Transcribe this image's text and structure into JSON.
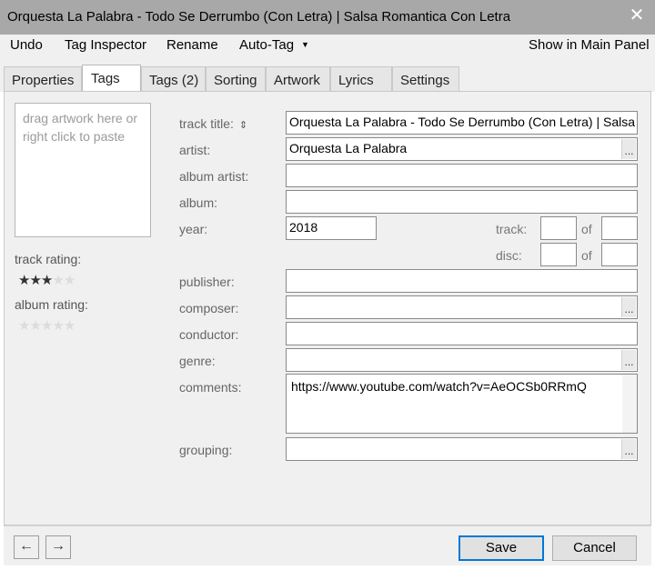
{
  "window": {
    "title": "Orquesta La Palabra - Todo Se Derrumbo (Con Letra) | Salsa Romantica Con Letra",
    "close_glyph": "✕"
  },
  "menu": {
    "undo": "Undo",
    "tag_inspector": "Tag Inspector",
    "rename": "Rename",
    "auto_tag": "Auto-Tag",
    "show_in_main_panel": "Show in Main Panel"
  },
  "tabs": [
    {
      "label": "Properties",
      "active": false
    },
    {
      "label": "Tags",
      "active": true
    },
    {
      "label": "Tags (2)",
      "active": false
    },
    {
      "label": "Sorting",
      "active": false
    },
    {
      "label": "Artwork",
      "active": false
    },
    {
      "label": "Lyrics",
      "active": false
    },
    {
      "label": "Settings",
      "active": false
    }
  ],
  "artwork": {
    "placeholder": "drag artwork here or right click to paste"
  },
  "ratings": {
    "track_rating_label": "track rating:",
    "track_rating_value": 3,
    "album_rating_label": "album rating:",
    "album_rating_value": 0,
    "max": 5
  },
  "fields": {
    "track_title": {
      "label": "track title:",
      "value": "Orquesta La Palabra - Todo Se Derrumbo (Con Letra) | Salsa Romantica Con Letra"
    },
    "artist": {
      "label": "artist:",
      "value": "Orquesta La Palabra"
    },
    "album_artist": {
      "label": "album artist:",
      "value": ""
    },
    "album": {
      "label": "album:",
      "value": ""
    },
    "year": {
      "label": "year:",
      "value": "2018"
    },
    "track": {
      "label": "track:",
      "value": "",
      "of_label": "of",
      "of_value": ""
    },
    "disc": {
      "label": "disc:",
      "value": "",
      "of_label": "of",
      "of_value": ""
    },
    "publisher": {
      "label": "publisher:",
      "value": ""
    },
    "composer": {
      "label": "composer:",
      "value": ""
    },
    "conductor": {
      "label": "conductor:",
      "value": ""
    },
    "genre": {
      "label": "genre:",
      "value": ""
    },
    "comments": {
      "label": "comments:",
      "value": "https://www.youtube.com/watch?v=AeOCSb0RRmQ"
    },
    "grouping": {
      "label": "grouping:",
      "value": ""
    }
  },
  "ellipsis": "...",
  "footer": {
    "back_glyph": "←",
    "forward_glyph": "→",
    "save": "Save",
    "cancel": "Cancel"
  },
  "colors": {
    "default_button_border": "#0078d7",
    "titlebar": "#a8a8a8"
  }
}
